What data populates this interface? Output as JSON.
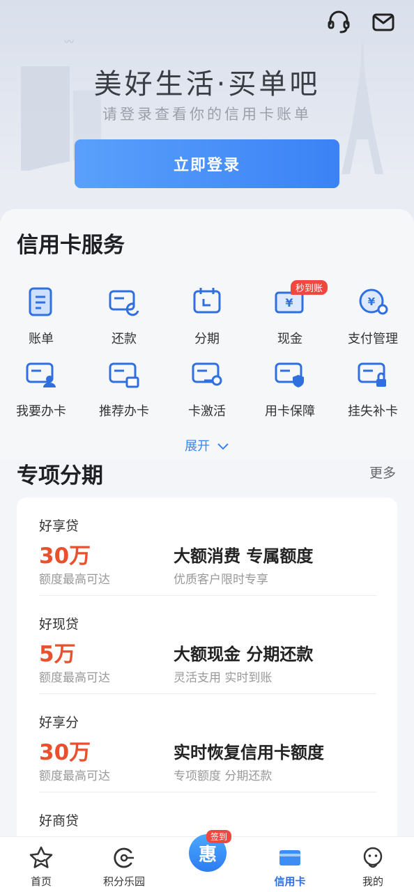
{
  "hero": {
    "title": "美好生活·买单吧",
    "subtitle": "请登录查看你的信用卡账单",
    "login_label": "立即登录"
  },
  "services": {
    "title": "信用卡服务",
    "items": [
      {
        "label": "账单",
        "icon": "bill-icon"
      },
      {
        "label": "还款",
        "icon": "repay-icon"
      },
      {
        "label": "分期",
        "icon": "calendar-icon"
      },
      {
        "label": "现金",
        "icon": "cash-icon",
        "badge": "秒到账"
      },
      {
        "label": "支付管理",
        "icon": "payment-settings-icon"
      },
      {
        "label": "我要办卡",
        "icon": "apply-card-icon"
      },
      {
        "label": "推荐办卡",
        "icon": "recommend-card-icon"
      },
      {
        "label": "卡激活",
        "icon": "activate-card-icon"
      },
      {
        "label": "用卡保障",
        "icon": "card-protect-icon"
      },
      {
        "label": "挂失补卡",
        "icon": "lost-card-icon"
      }
    ],
    "expand_label": "展开"
  },
  "installment": {
    "title": "专项分期",
    "more_label": "更多",
    "items": [
      {
        "name": "好享贷",
        "amount": "30万",
        "amount_note": "额度最高可达",
        "headline": "大额消费 专属额度",
        "desc": "优质客户限时专享"
      },
      {
        "name": "好现贷",
        "amount": "5万",
        "amount_note": "额度最高可达",
        "headline": "大额现金 分期还款",
        "desc": "灵活支用 实时到账"
      },
      {
        "name": "好享分",
        "amount": "30万",
        "amount_note": "额度最高可达",
        "headline": "实时恢复信用卡额度",
        "desc": "专项额度 分期还款"
      },
      {
        "name": "好商贷",
        "amount": "",
        "amount_note": "",
        "headline": "",
        "desc": ""
      }
    ]
  },
  "nav": {
    "items": [
      {
        "label": "首页",
        "icon": "home-star-icon"
      },
      {
        "label": "积分乐园",
        "icon": "points-icon"
      },
      {
        "label": "",
        "icon": "sign-in-icon"
      },
      {
        "label": "信用卡",
        "icon": "credit-card-icon",
        "active": true
      },
      {
        "label": "我的",
        "icon": "profile-icon"
      }
    ],
    "center_badge": "签到",
    "center_glyph": "惠"
  },
  "colors": {
    "accent": "#3b82f6",
    "amount": "#e8502e",
    "badge": "#f0483e"
  }
}
